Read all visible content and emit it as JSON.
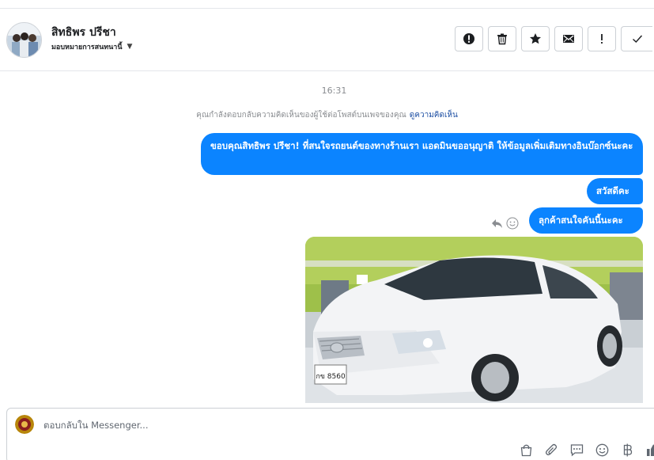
{
  "header": {
    "contact_name": "สิทธิพร ปรีชา",
    "assign_label": "มอบหมายการสนทนานี้",
    "actions": [
      {
        "icon": "alert-circle-icon",
        "name": "mark-spam-button"
      },
      {
        "icon": "trash-icon",
        "name": "delete-button"
      },
      {
        "icon": "star-icon",
        "name": "star-button"
      },
      {
        "icon": "envelope-icon",
        "name": "mark-unread-button"
      },
      {
        "icon": "exclamation-icon",
        "name": "flag-button"
      },
      {
        "icon": "check-icon",
        "name": "mark-done-button"
      }
    ]
  },
  "conversation": {
    "timestamp": "16:31",
    "notice_text": "คุณกำลังตอบกลับความคิดเห็นของผู้ใช้ต่อโพสต์บนเพจของคุณ",
    "notice_link": "ดูความคิดเห็น",
    "messages": [
      {
        "text": "ขอบคุณสิทธิพร ปรีชา! ที่สนใจรถยนต์ของทางร้านเรา แอดมินขออนุญาติ ให้ข้อมูลเพิ่มเติมทางอินบ๊อกซ์นะคะ"
      },
      {
        "text": "สวัสดีคะ"
      },
      {
        "text": "ลุกค้าสนใจคันนี้นะคะ"
      }
    ],
    "photo": {
      "plate_text": "กข 8560"
    }
  },
  "composer": {
    "placeholder": "ตอบกลับใน Messenger...",
    "tools": [
      "shopping-bag-icon",
      "paperclip-icon",
      "saved-reply-icon",
      "emoji-icon",
      "baht-icon",
      "thumbs-up-icon"
    ]
  },
  "colors": {
    "bubble": "#0b84ff",
    "link": "#1d4fa3",
    "muted_text": "#8a8d91",
    "border": "#ccd0d5"
  }
}
